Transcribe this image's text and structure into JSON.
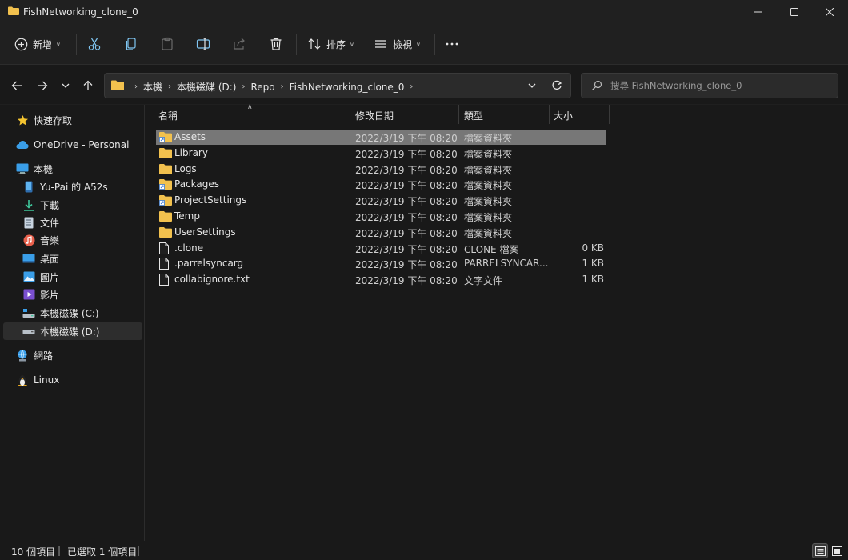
{
  "window": {
    "title": "FishNetworking_clone_0"
  },
  "toolbar": {
    "new_label": "新增",
    "sort_label": "排序",
    "view_label": "檢視",
    "icons": [
      "plus-circle-icon",
      "cut-icon",
      "copy-icon",
      "paste-icon",
      "rename-icon",
      "share-icon",
      "delete-icon",
      "sort-icon",
      "view-icon",
      "more-icon"
    ]
  },
  "address": {
    "breadcrumbs": [
      "本機",
      "本機磁碟 (D:)",
      "Repo",
      "FishNetworking_clone_0"
    ]
  },
  "search": {
    "placeholder": "搜尋 FishNetworking_clone_0"
  },
  "sidebar": {
    "items": [
      {
        "label": "快速存取",
        "icon": "star-icon"
      },
      {
        "label": "OneDrive - Personal",
        "icon": "cloud-icon"
      },
      {
        "label": "本機",
        "icon": "computer-icon"
      },
      {
        "label": "Yu-Pai 的 A52s",
        "icon": "phone-icon"
      },
      {
        "label": "下載",
        "icon": "download-icon"
      },
      {
        "label": "文件",
        "icon": "document-icon"
      },
      {
        "label": "音樂",
        "icon": "music-icon"
      },
      {
        "label": "桌面",
        "icon": "desktop-icon"
      },
      {
        "label": "圖片",
        "icon": "pictures-icon"
      },
      {
        "label": "影片",
        "icon": "videos-icon"
      },
      {
        "label": "本機磁碟 (C:)",
        "icon": "drive-c-icon"
      },
      {
        "label": "本機磁碟 (D:)",
        "icon": "drive-d-icon",
        "selected": true
      },
      {
        "label": "網路",
        "icon": "network-icon"
      },
      {
        "label": "Linux",
        "icon": "linux-icon"
      }
    ]
  },
  "columns": {
    "name": "名稱",
    "modified": "修改日期",
    "type": "類型",
    "size": "大小"
  },
  "files": [
    {
      "name": "Assets",
      "modified": "2022/3/19 下午 08:20",
      "type": "檔案資料夾",
      "size": "",
      "kind": "folder-shortcut",
      "selected": true
    },
    {
      "name": "Library",
      "modified": "2022/3/19 下午 08:20",
      "type": "檔案資料夾",
      "size": "",
      "kind": "folder"
    },
    {
      "name": "Logs",
      "modified": "2022/3/19 下午 08:20",
      "type": "檔案資料夾",
      "size": "",
      "kind": "folder"
    },
    {
      "name": "Packages",
      "modified": "2022/3/19 下午 08:20",
      "type": "檔案資料夾",
      "size": "",
      "kind": "folder-shortcut"
    },
    {
      "name": "ProjectSettings",
      "modified": "2022/3/19 下午 08:20",
      "type": "檔案資料夾",
      "size": "",
      "kind": "folder-shortcut"
    },
    {
      "name": "Temp",
      "modified": "2022/3/19 下午 08:20",
      "type": "檔案資料夾",
      "size": "",
      "kind": "folder"
    },
    {
      "name": "UserSettings",
      "modified": "2022/3/19 下午 08:20",
      "type": "檔案資料夾",
      "size": "",
      "kind": "folder"
    },
    {
      "name": ".clone",
      "modified": "2022/3/19 下午 08:20",
      "type": "CLONE 檔案",
      "size": "0 KB",
      "kind": "file"
    },
    {
      "name": ".parrelsyncarg",
      "modified": "2022/3/19 下午 08:20",
      "type": "PARRELSYNCAR...",
      "size": "1 KB",
      "kind": "file"
    },
    {
      "name": "collabignore.txt",
      "modified": "2022/3/19 下午 08:20",
      "type": "文字文件",
      "size": "1 KB",
      "kind": "file"
    }
  ],
  "status": {
    "item_count": "10 個項目",
    "selection": "已選取 1 個項目"
  },
  "colors": {
    "folder": "#f2c14e",
    "selected_row": "#777777",
    "accent": "#4cc2ff"
  }
}
